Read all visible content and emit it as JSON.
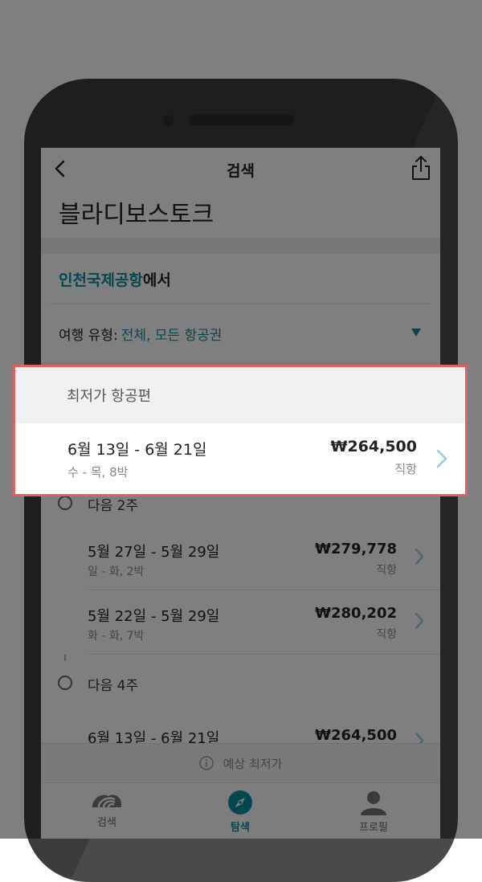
{
  "nav": {
    "title": "검색",
    "back_icon": "chevron-left-icon",
    "share_icon": "share-icon"
  },
  "page_title": "블라디보스토크",
  "origin": {
    "airport": "인천국제공항",
    "suffix": "에서"
  },
  "trip_type": {
    "label": "여행 유형:",
    "value": "전체, 모든 항공권"
  },
  "cheapest": {
    "heading": "최저가 항공편",
    "dates": "6월 13일 - 6월 21일",
    "days": "수 - 목, 8박",
    "price": "₩264,500",
    "direct": "직항"
  },
  "groups": [
    {
      "label": "다음 2주",
      "flights": [
        {
          "dates": "5월 27일 - 5월 29일",
          "days": "일 - 화, 2박",
          "price": "₩279,778",
          "direct": "직항"
        },
        {
          "dates": "5월 22일 - 5월 29일",
          "days": "화 - 화, 7박",
          "price": "₩280,202",
          "direct": "직항"
        }
      ]
    },
    {
      "label": "다음 4주",
      "flights": [
        {
          "dates": "6월 13일 - 6월 21일",
          "days": "",
          "price": "₩264,500",
          "direct": ""
        }
      ]
    }
  ],
  "forecast": {
    "label": "예상 최저가"
  },
  "tabs": [
    {
      "label": "검색",
      "icon": "skyscanner-logo-icon",
      "active": false
    },
    {
      "label": "탐색",
      "icon": "compass-icon",
      "active": true
    },
    {
      "label": "프로필",
      "icon": "person-icon",
      "active": false
    }
  ],
  "colors": {
    "accent": "#0a8fa0",
    "highlight_border": "#e4605f",
    "phone_body": "#3c3c3c"
  }
}
